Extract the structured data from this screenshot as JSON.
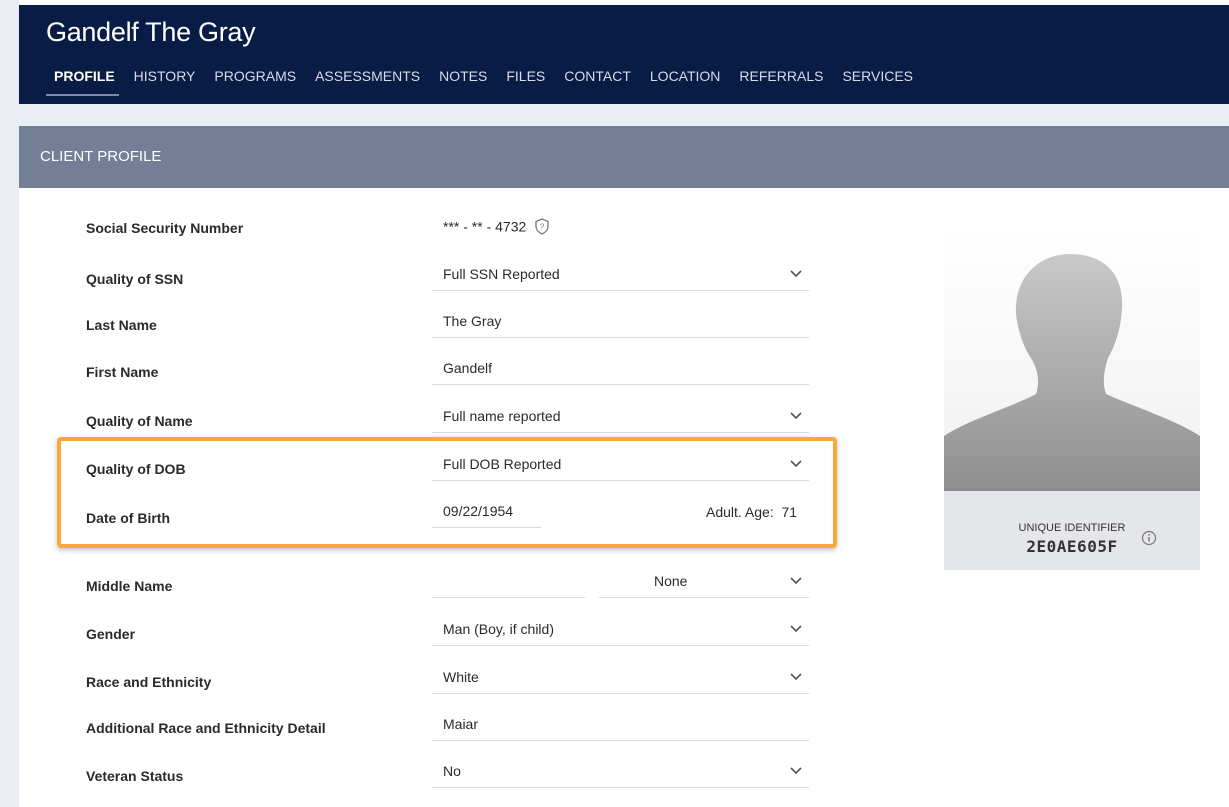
{
  "header": {
    "title": "Gandelf The Gray",
    "tabs": [
      {
        "label": "PROFILE",
        "active": true
      },
      {
        "label": "HISTORY"
      },
      {
        "label": "PROGRAMS"
      },
      {
        "label": "ASSESSMENTS"
      },
      {
        "label": "NOTES"
      },
      {
        "label": "FILES"
      },
      {
        "label": "CONTACT"
      },
      {
        "label": "LOCATION"
      },
      {
        "label": "REFERRALS"
      },
      {
        "label": "SERVICES"
      }
    ]
  },
  "section": {
    "title": "CLIENT PROFILE"
  },
  "form": {
    "ssn": {
      "label": "Social Security Number",
      "value": "*** - ** - 4732"
    },
    "ssn_quality": {
      "label": "Quality of SSN",
      "value": "Full SSN Reported"
    },
    "last_name": {
      "label": "Last Name",
      "value": "The Gray"
    },
    "first_name": {
      "label": "First Name",
      "value": "Gandelf"
    },
    "name_quality": {
      "label": "Quality of Name",
      "value": "Full name reported"
    },
    "dob_quality": {
      "label": "Quality of DOB",
      "value": "Full DOB Reported"
    },
    "dob": {
      "label": "Date of Birth",
      "value": "09/22/1954",
      "age_text": "Adult. Age:  71"
    },
    "middle_name": {
      "label": "Middle Name",
      "value": "",
      "suffix": "None"
    },
    "gender": {
      "label": "Gender",
      "value": "Man (Boy, if child)"
    },
    "race": {
      "label": "Race and Ethnicity",
      "value": "White"
    },
    "race_detail": {
      "label": "Additional Race and Ethnicity Detail",
      "value": "Maiar"
    },
    "veteran": {
      "label": "Veteran Status",
      "value": "No"
    }
  },
  "profile_card": {
    "uid_label": "UNIQUE IDENTIFIER",
    "uid_value": "2E0AE605F"
  },
  "colors": {
    "header_bg": "#081c46",
    "section_bg": "#737f96",
    "highlight": "#f7a93b"
  }
}
